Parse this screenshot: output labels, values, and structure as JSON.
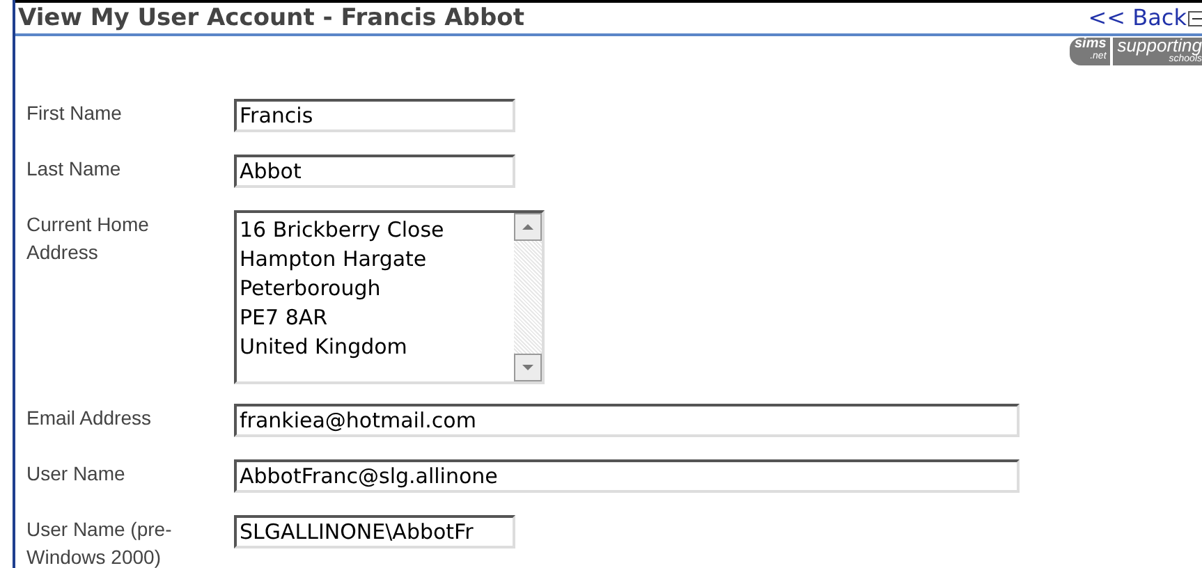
{
  "header": {
    "title": "View My User Account - Francis Abbot",
    "back_link": "<< Back"
  },
  "logo": {
    "left_top": "sims",
    "left_bottom": ".net",
    "right_top": "supporting",
    "right_bottom": "schools"
  },
  "fields": [
    {
      "kind": "short_input",
      "label": "First Name",
      "value": "Francis"
    },
    {
      "kind": "short_input",
      "label": "Last Name",
      "value": "Abbot"
    },
    {
      "kind": "textarea",
      "label": "Current Home Address",
      "lines": [
        "16 Brickberry Close",
        "Hampton Hargate",
        "Peterborough",
        "PE7 8AR",
        "United Kingdom"
      ]
    },
    {
      "kind": "long_input",
      "label": "Email Address",
      "value": "frankiea@hotmail.com"
    },
    {
      "kind": "long_input",
      "label": "User Name",
      "value": "AbbotFranc@slg.allinone"
    },
    {
      "kind": "short_input",
      "label": "User Name (pre-Windows 2000)",
      "value": "SLGALLINONE\\AbbotFr"
    }
  ]
}
